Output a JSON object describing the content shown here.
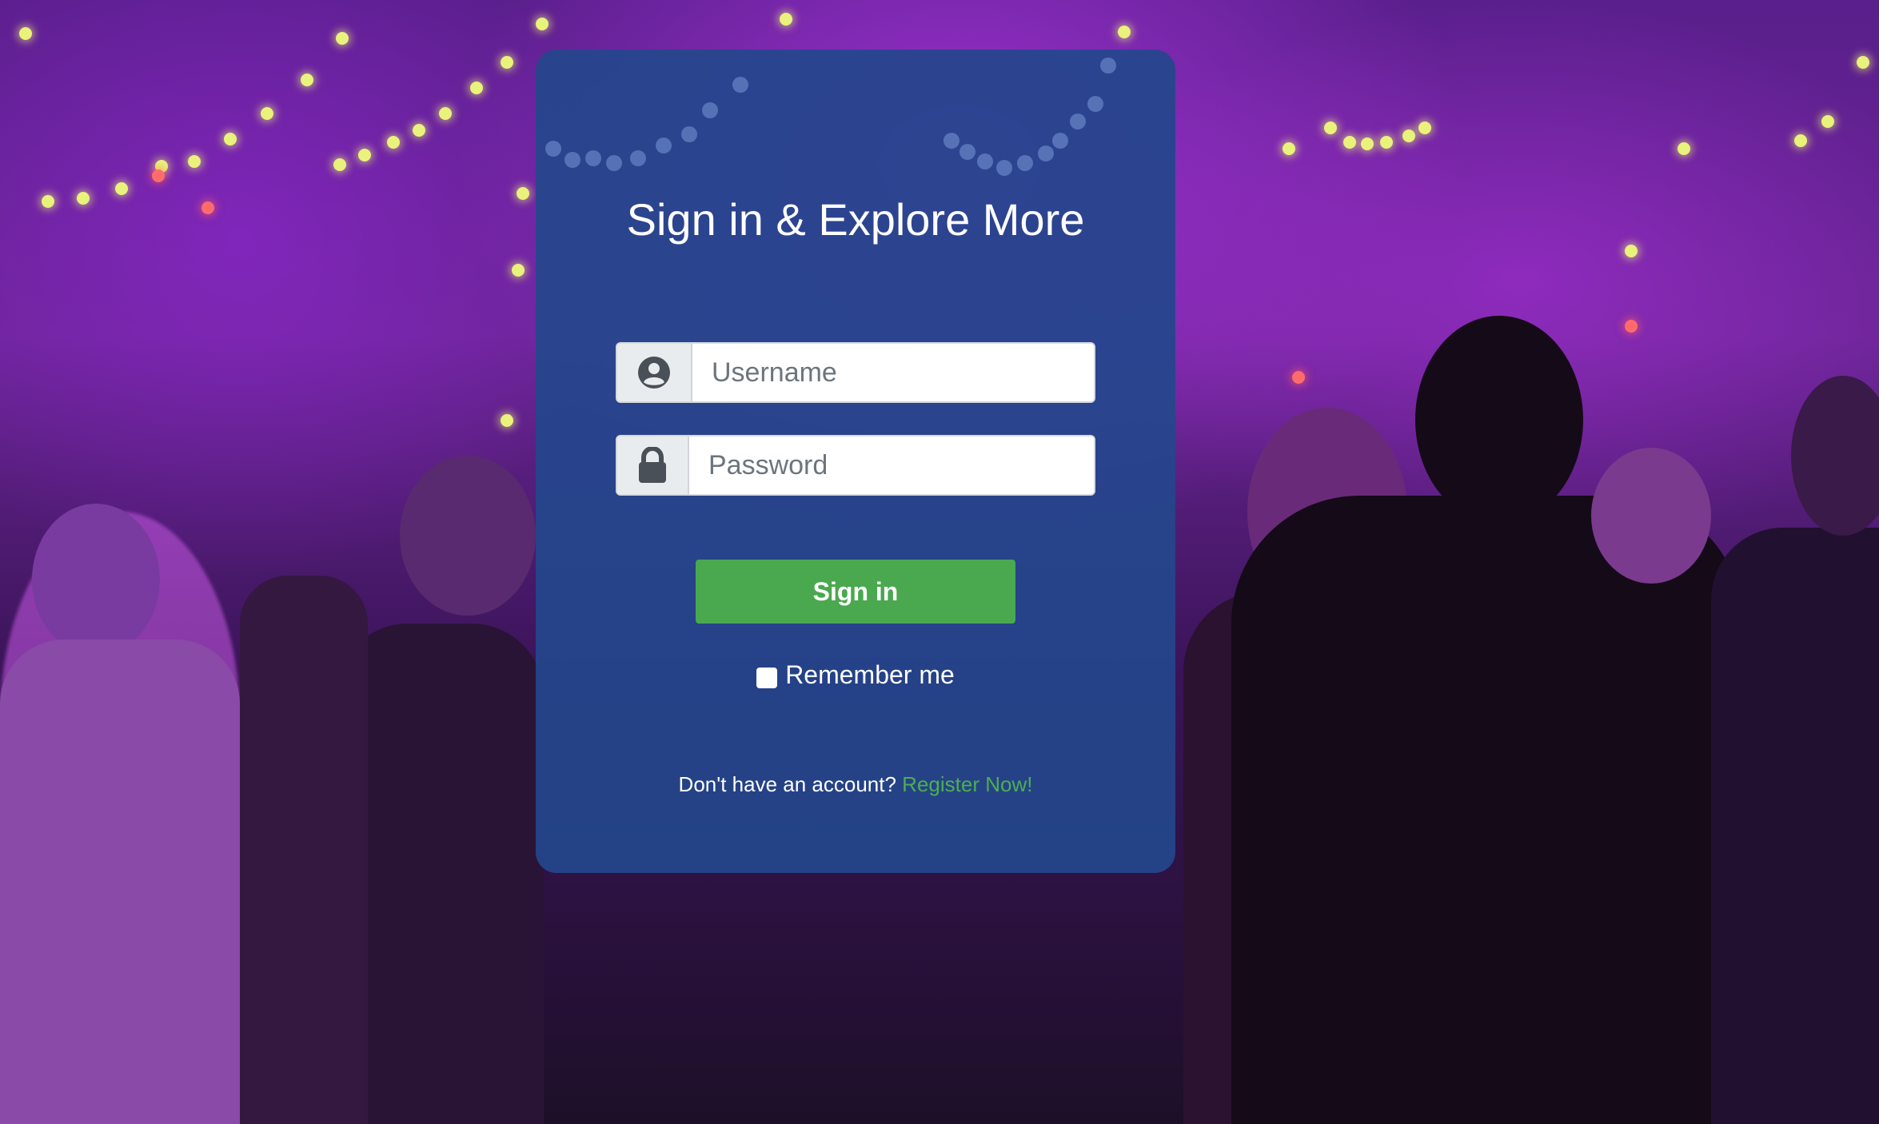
{
  "background": {
    "description_icon": "party-crowd-photo",
    "accent": "#8a2be2"
  },
  "form": {
    "title": "Sign in & Explore More",
    "username": {
      "placeholder": "Username",
      "icon": "user-circle-icon"
    },
    "password": {
      "placeholder": "Password",
      "icon": "lock-icon"
    },
    "submit_label": "Sign in",
    "remember_label": "Remember me",
    "register_prompt": "Don't have an account?",
    "register_link": "Register Now!"
  },
  "colors": {
    "panel": "#24468c",
    "button": "#4aa84f",
    "link": "#4caf50"
  }
}
